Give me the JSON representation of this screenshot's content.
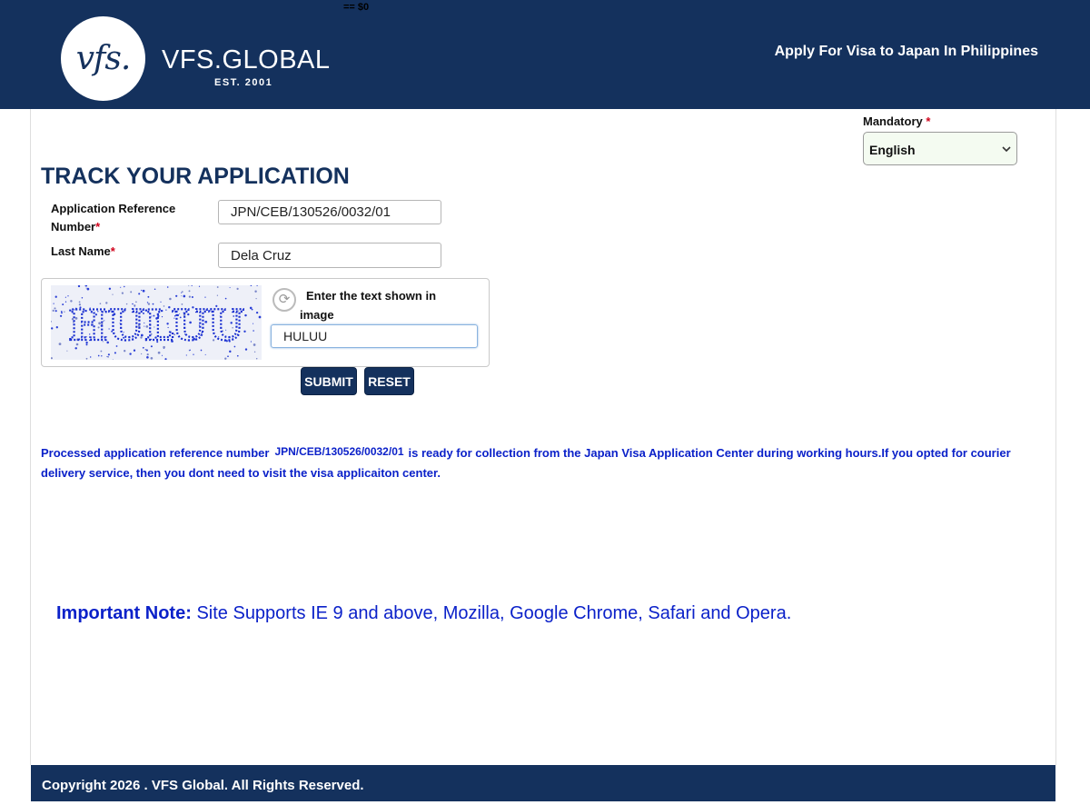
{
  "header": {
    "debug_text": "== $0",
    "logo_mark": "vfs.",
    "brand": "VFS.GLOBAL",
    "est": "EST. 2001",
    "apply_text": "Apply For Visa to Japan  In Philippines",
    "background": "#14315d"
  },
  "language": {
    "mandatory_label": "Mandatory",
    "required_marker": "*",
    "selected": "English"
  },
  "form": {
    "title": "TRACK YOUR APPLICATION",
    "ref_label": "Application Reference Number",
    "ref_value": "JPN/CEB/130526/0032/01",
    "lastname_label": "Last Name",
    "lastname_value": "Dela Cruz",
    "required_marker": "*",
    "captcha_image_text": "HULUU",
    "captcha_label": "Enter the text shown in image",
    "captcha_value": "HULUU",
    "submit_label": "SUBMIT",
    "reset_label": "RESET"
  },
  "result": {
    "prefix": "Processed application reference number",
    "reference": "JPN/CEB/130526/0032/01",
    "suffix": "is ready for collection from the Japan Visa Application Center during working hours.If you opted for courier delivery service, then you dont need to visit the visa applicaiton center."
  },
  "note": {
    "label": "Important Note:",
    "text": "Site Supports IE 9 and above, Mozilla, Google Chrome, Safari and Opera."
  },
  "footer": {
    "copyright": "Copyright 2026 . VFS Global. All Rights Reserved."
  },
  "colors": {
    "navy": "#14315d",
    "message_blue": "#0b21c9",
    "required_red": "#d0021b"
  }
}
